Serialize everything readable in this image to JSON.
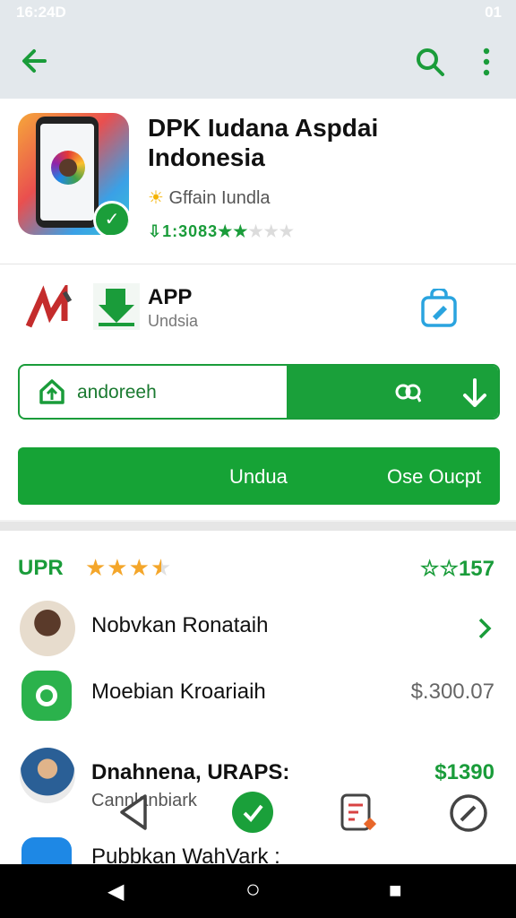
{
  "status_bar": {
    "time": "16:24D",
    "right": "01"
  },
  "app": {
    "title": "DPK  Iudana Aspdai Indonesia",
    "developer": "Gffain Iundla",
    "rating_text": "1:3083",
    "app_label": "APP",
    "app_sublabel": "Undsia"
  },
  "search": {
    "text": "andoreeh"
  },
  "action_button": {
    "label_left": "Undua",
    "label_right": "Ose Oucpt"
  },
  "ratings_section": {
    "title": "UPR",
    "stars": 3.5,
    "count": "157"
  },
  "list": [
    {
      "name": "Nobvkan Ronataih",
      "value": "",
      "sub": ""
    },
    {
      "name": "Moebian Kroariaih",
      "value": "$.300.07",
      "sub": ""
    },
    {
      "name": "Dnahnena, URAPS:",
      "value": "$1390",
      "sub": "Cannlanbiark"
    },
    {
      "name": "Pubbkan WahVark :",
      "value": "",
      "sub": ""
    }
  ],
  "colors": {
    "accent": "#1aa03a",
    "star": "#f4a62a"
  }
}
